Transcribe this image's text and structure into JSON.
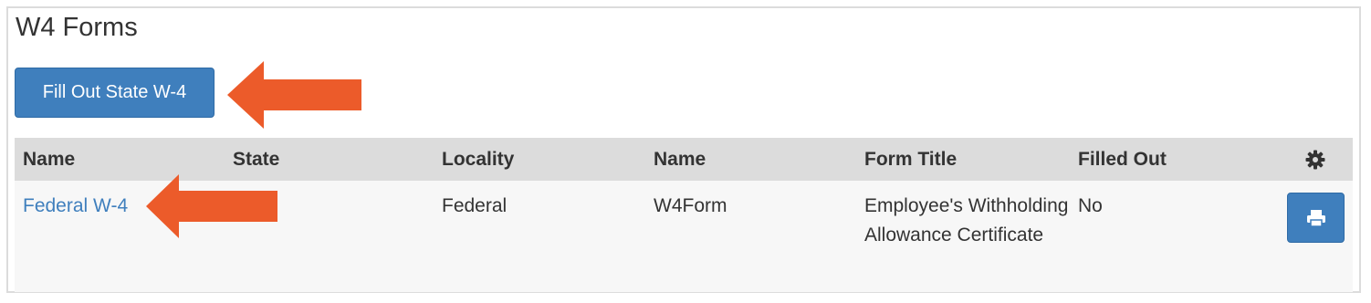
{
  "page": {
    "title": "W4 Forms"
  },
  "actions": {
    "fill_state_label": "Fill Out State W-4"
  },
  "table": {
    "columns": [
      "Name",
      "State",
      "Locality",
      "Name",
      "Form Title",
      "Filled Out"
    ],
    "settings_icon": "gear-icon",
    "rows": [
      {
        "name": "Federal W-4",
        "state": "",
        "locality": "Federal",
        "form_name": "W4Form",
        "form_title": "Employee's Withholding Allowance Certificate",
        "filled_out": "No",
        "action_icon": "print-icon"
      }
    ]
  },
  "colors": {
    "primary": "#3f7fbd",
    "annotation_arrow": "#ec5b2a",
    "header_bg": "#dcdcdc",
    "row_bg": "#f7f7f7"
  }
}
